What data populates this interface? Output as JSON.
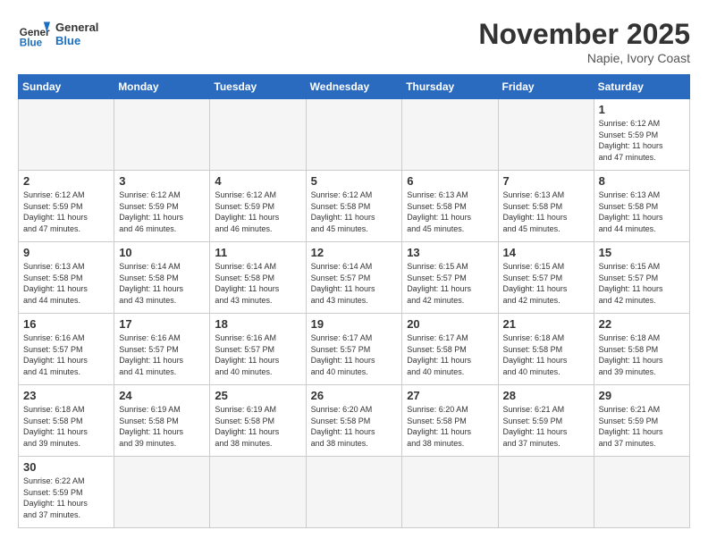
{
  "header": {
    "logo_general": "General",
    "logo_blue": "Blue",
    "month_title": "November 2025",
    "location": "Napie, Ivory Coast"
  },
  "weekdays": [
    "Sunday",
    "Monday",
    "Tuesday",
    "Wednesday",
    "Thursday",
    "Friday",
    "Saturday"
  ],
  "days": [
    {
      "date": "",
      "info": ""
    },
    {
      "date": "",
      "info": ""
    },
    {
      "date": "",
      "info": ""
    },
    {
      "date": "",
      "info": ""
    },
    {
      "date": "",
      "info": ""
    },
    {
      "date": "",
      "info": ""
    },
    {
      "date": "1",
      "info": "Sunrise: 6:12 AM\nSunset: 5:59 PM\nDaylight: 11 hours\nand 47 minutes."
    },
    {
      "date": "2",
      "info": "Sunrise: 6:12 AM\nSunset: 5:59 PM\nDaylight: 11 hours\nand 47 minutes."
    },
    {
      "date": "3",
      "info": "Sunrise: 6:12 AM\nSunset: 5:59 PM\nDaylight: 11 hours\nand 46 minutes."
    },
    {
      "date": "4",
      "info": "Sunrise: 6:12 AM\nSunset: 5:59 PM\nDaylight: 11 hours\nand 46 minutes."
    },
    {
      "date": "5",
      "info": "Sunrise: 6:12 AM\nSunset: 5:58 PM\nDaylight: 11 hours\nand 45 minutes."
    },
    {
      "date": "6",
      "info": "Sunrise: 6:13 AM\nSunset: 5:58 PM\nDaylight: 11 hours\nand 45 minutes."
    },
    {
      "date": "7",
      "info": "Sunrise: 6:13 AM\nSunset: 5:58 PM\nDaylight: 11 hours\nand 45 minutes."
    },
    {
      "date": "8",
      "info": "Sunrise: 6:13 AM\nSunset: 5:58 PM\nDaylight: 11 hours\nand 44 minutes."
    },
    {
      "date": "9",
      "info": "Sunrise: 6:13 AM\nSunset: 5:58 PM\nDaylight: 11 hours\nand 44 minutes."
    },
    {
      "date": "10",
      "info": "Sunrise: 6:14 AM\nSunset: 5:58 PM\nDaylight: 11 hours\nand 43 minutes."
    },
    {
      "date": "11",
      "info": "Sunrise: 6:14 AM\nSunset: 5:58 PM\nDaylight: 11 hours\nand 43 minutes."
    },
    {
      "date": "12",
      "info": "Sunrise: 6:14 AM\nSunset: 5:57 PM\nDaylight: 11 hours\nand 43 minutes."
    },
    {
      "date": "13",
      "info": "Sunrise: 6:15 AM\nSunset: 5:57 PM\nDaylight: 11 hours\nand 42 minutes."
    },
    {
      "date": "14",
      "info": "Sunrise: 6:15 AM\nSunset: 5:57 PM\nDaylight: 11 hours\nand 42 minutes."
    },
    {
      "date": "15",
      "info": "Sunrise: 6:15 AM\nSunset: 5:57 PM\nDaylight: 11 hours\nand 42 minutes."
    },
    {
      "date": "16",
      "info": "Sunrise: 6:16 AM\nSunset: 5:57 PM\nDaylight: 11 hours\nand 41 minutes."
    },
    {
      "date": "17",
      "info": "Sunrise: 6:16 AM\nSunset: 5:57 PM\nDaylight: 11 hours\nand 41 minutes."
    },
    {
      "date": "18",
      "info": "Sunrise: 6:16 AM\nSunset: 5:57 PM\nDaylight: 11 hours\nand 40 minutes."
    },
    {
      "date": "19",
      "info": "Sunrise: 6:17 AM\nSunset: 5:57 PM\nDaylight: 11 hours\nand 40 minutes."
    },
    {
      "date": "20",
      "info": "Sunrise: 6:17 AM\nSunset: 5:58 PM\nDaylight: 11 hours\nand 40 minutes."
    },
    {
      "date": "21",
      "info": "Sunrise: 6:18 AM\nSunset: 5:58 PM\nDaylight: 11 hours\nand 40 minutes."
    },
    {
      "date": "22",
      "info": "Sunrise: 6:18 AM\nSunset: 5:58 PM\nDaylight: 11 hours\nand 39 minutes."
    },
    {
      "date": "23",
      "info": "Sunrise: 6:18 AM\nSunset: 5:58 PM\nDaylight: 11 hours\nand 39 minutes."
    },
    {
      "date": "24",
      "info": "Sunrise: 6:19 AM\nSunset: 5:58 PM\nDaylight: 11 hours\nand 39 minutes."
    },
    {
      "date": "25",
      "info": "Sunrise: 6:19 AM\nSunset: 5:58 PM\nDaylight: 11 hours\nand 38 minutes."
    },
    {
      "date": "26",
      "info": "Sunrise: 6:20 AM\nSunset: 5:58 PM\nDaylight: 11 hours\nand 38 minutes."
    },
    {
      "date": "27",
      "info": "Sunrise: 6:20 AM\nSunset: 5:58 PM\nDaylight: 11 hours\nand 38 minutes."
    },
    {
      "date": "28",
      "info": "Sunrise: 6:21 AM\nSunset: 5:59 PM\nDaylight: 11 hours\nand 37 minutes."
    },
    {
      "date": "29",
      "info": "Sunrise: 6:21 AM\nSunset: 5:59 PM\nDaylight: 11 hours\nand 37 minutes."
    },
    {
      "date": "30",
      "info": "Sunrise: 6:22 AM\nSunset: 5:59 PM\nDaylight: 11 hours\nand 37 minutes."
    }
  ]
}
